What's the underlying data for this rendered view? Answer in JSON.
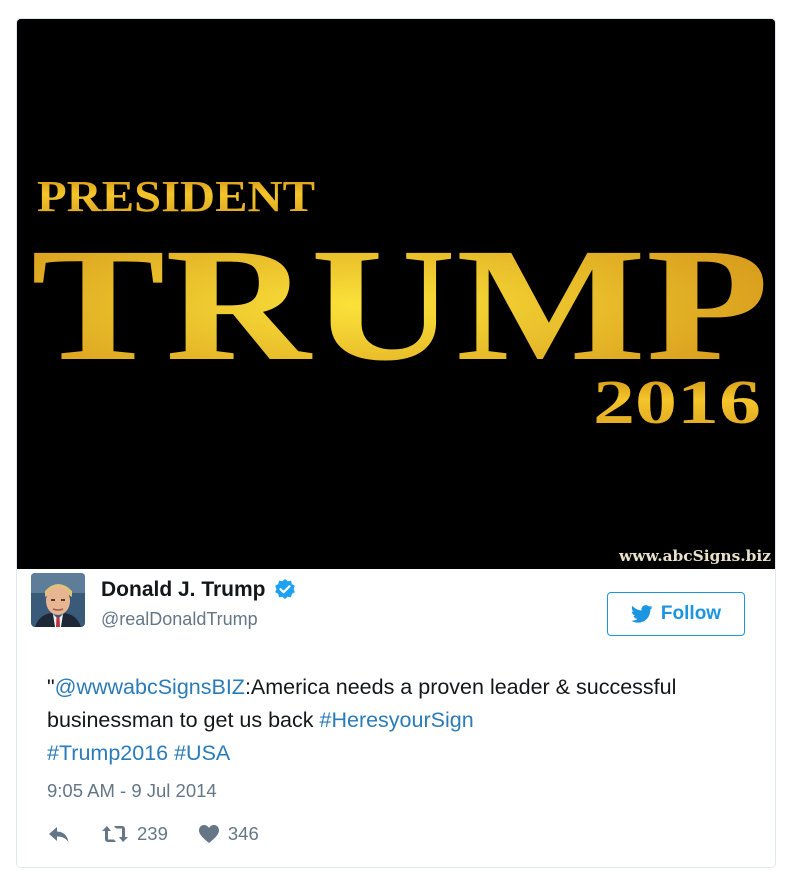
{
  "media": {
    "line1": "PRESIDENT",
    "line2": "TRUMP",
    "line3": "2016",
    "watermark": "www.abcSigns.biz",
    "gold": "#e3a81c",
    "background": "#000000"
  },
  "author": {
    "display_name": "Donald J. Trump",
    "handle": "@realDonaldTrump",
    "avatar_icon": "profile-photo",
    "verified_icon": "verified-badge-icon"
  },
  "follow_button": {
    "label": "Follow",
    "icon": "twitter-bird-icon",
    "color": "#1b95e0"
  },
  "tweet": {
    "quote_open": "\"",
    "mention": "@wwwabcSignsBIZ",
    "text_part1": ":America needs a proven leader & successful businessman to get us back ",
    "hashtag1": "#HeresyourSign",
    "hashtag2": "#Trump2016",
    "hashtag3": "#USA",
    "link_color": "#2b7bb9"
  },
  "timestamp": "9:05 AM - 9 Jul 2014",
  "actions": {
    "reply_icon": "reply-icon",
    "retweet_icon": "retweet-icon",
    "retweet_count": "239",
    "like_icon": "heart-icon",
    "like_count": "346"
  }
}
